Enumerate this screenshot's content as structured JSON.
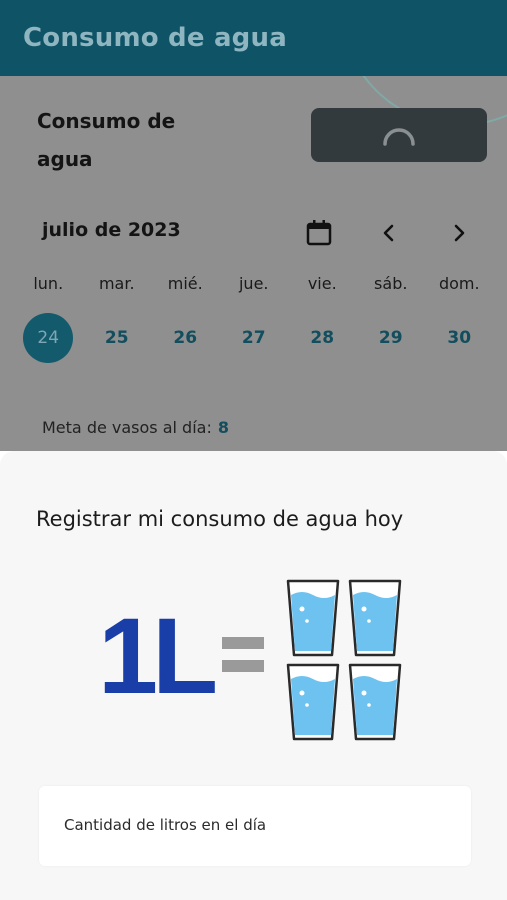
{
  "appbar": {
    "title": "Consumo de agua"
  },
  "section": {
    "title": "Consumo de agua"
  },
  "calendar": {
    "month": "julio de 2023",
    "weekdays": [
      "lun.",
      "mar.",
      "mié.",
      "jue.",
      "vie.",
      "sáb.",
      "dom."
    ],
    "days": [
      "24",
      "25",
      "26",
      "27",
      "28",
      "29",
      "30"
    ]
  },
  "goal": {
    "label": "Meta de vasos al día:",
    "value": "8"
  },
  "sheet": {
    "title": "Registrar mi consumo de agua hoy",
    "illustration_text": "1L",
    "input_label": "Cantidad de litros en el día"
  },
  "colors": {
    "appbar": "#0e5466",
    "accent": "#135a6c",
    "water": "#6ec2ef",
    "brand_blue": "#1a3ea8"
  },
  "icons": [
    "loading-spinner-icon",
    "calendar-icon",
    "chevron-left-icon",
    "chevron-right-icon",
    "water-glass-icon"
  ]
}
